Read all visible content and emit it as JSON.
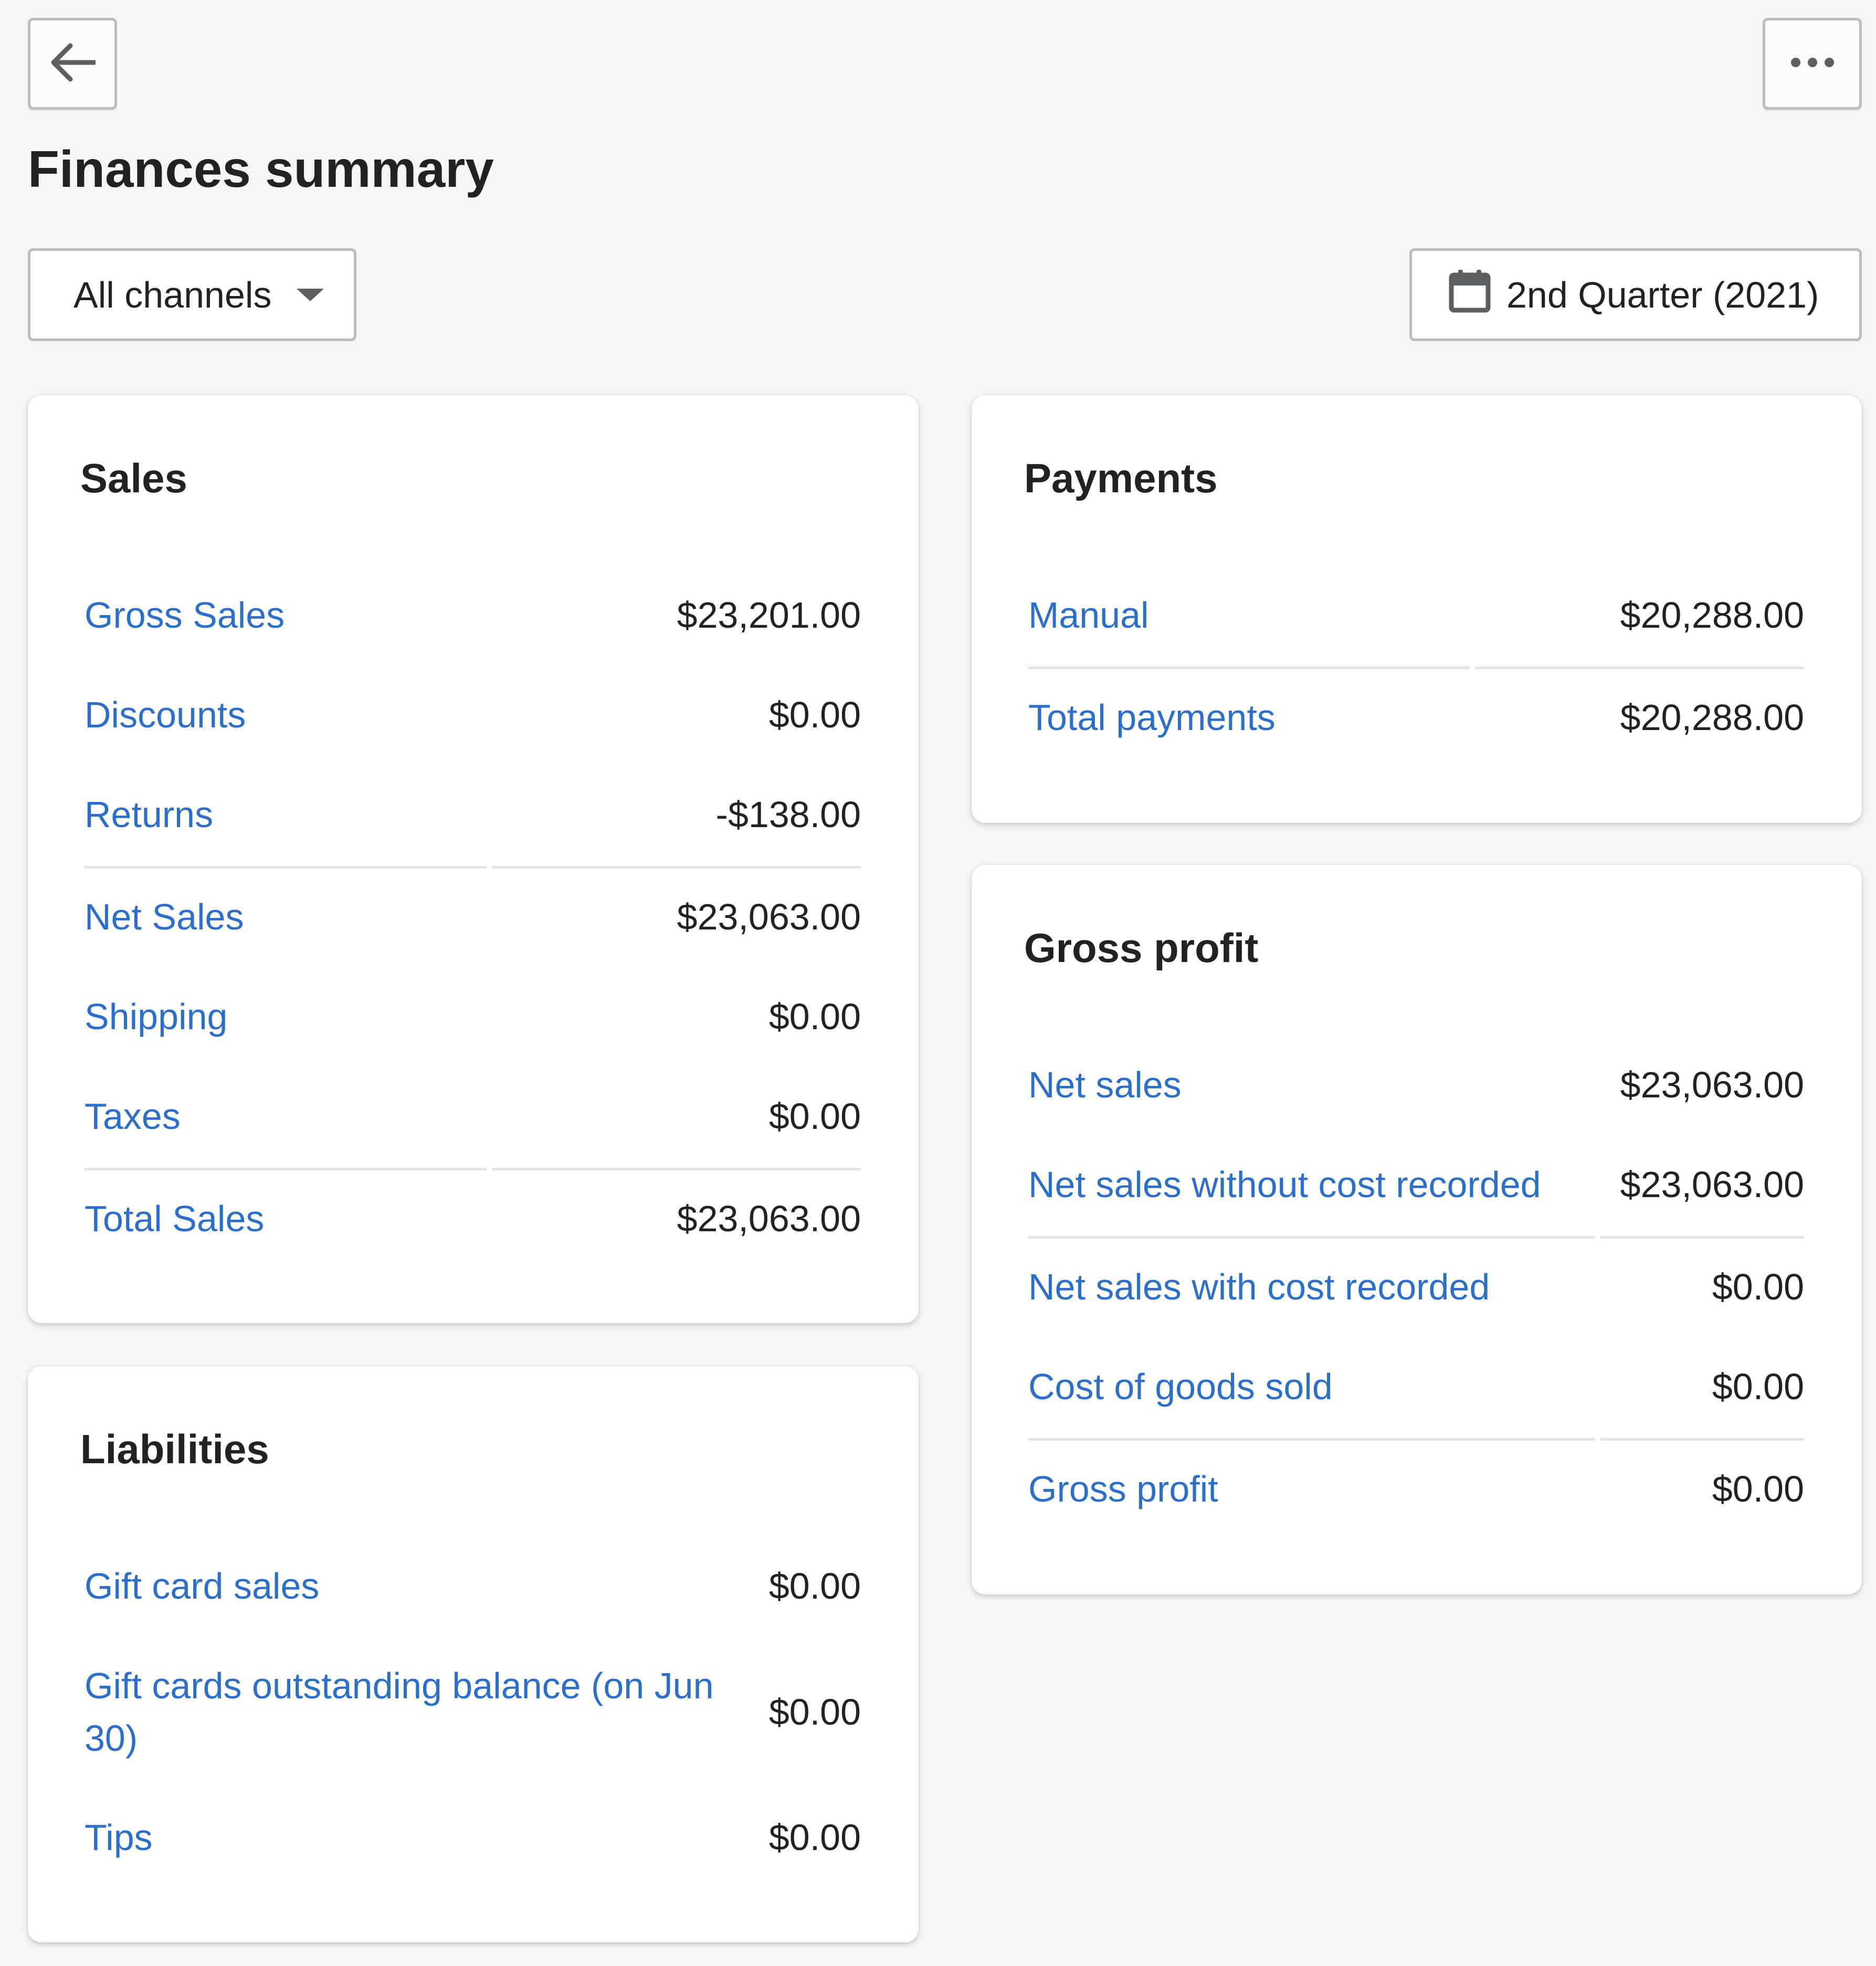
{
  "header": {
    "back_icon": "arrow-left-icon",
    "more_icon": "horizontal-dots-icon",
    "title": "Finances summary"
  },
  "filters": {
    "channel_select": "All channels",
    "date_range": "2nd Quarter (2021)",
    "date_icon": "calendar-icon"
  },
  "sales": {
    "title": "Sales",
    "rows": [
      {
        "label": "Gross Sales",
        "value": "$23,201.00"
      },
      {
        "label": "Discounts",
        "value": "$0.00"
      },
      {
        "label": "Returns",
        "value": "-$138.00"
      },
      {
        "label": "Net Sales",
        "value": "$23,063.00"
      },
      {
        "label": "Shipping",
        "value": "$0.00"
      },
      {
        "label": "Taxes",
        "value": "$0.00"
      },
      {
        "label": "Total Sales",
        "value": "$23,063.00"
      }
    ]
  },
  "liabilities": {
    "title": "Liabilities",
    "rows": [
      {
        "label": "Gift card sales",
        "value": "$0.00"
      },
      {
        "label": "Gift cards outstanding balance (on Jun 30)",
        "value": "$0.00"
      },
      {
        "label": "Tips",
        "value": "$0.00"
      }
    ]
  },
  "payments": {
    "title": "Payments",
    "rows": [
      {
        "label": "Manual",
        "value": "$20,288.00"
      },
      {
        "label": "Total payments",
        "value": "$20,288.00"
      }
    ]
  },
  "gross_profit": {
    "title": "Gross profit",
    "rows": [
      {
        "label": "Net sales",
        "value": "$23,063.00"
      },
      {
        "label": "Net sales without cost recorded",
        "value": "$23,063.00"
      },
      {
        "label": "Net sales with cost recorded",
        "value": "$0.00"
      },
      {
        "label": "Cost of goods sold",
        "value": "$0.00"
      },
      {
        "label": "Gross profit",
        "value": "$0.00"
      }
    ]
  },
  "colors": {
    "link": "#2c6ecb",
    "text": "#202223",
    "background": "#f5f5f5",
    "divider": "#e1e3e5"
  }
}
